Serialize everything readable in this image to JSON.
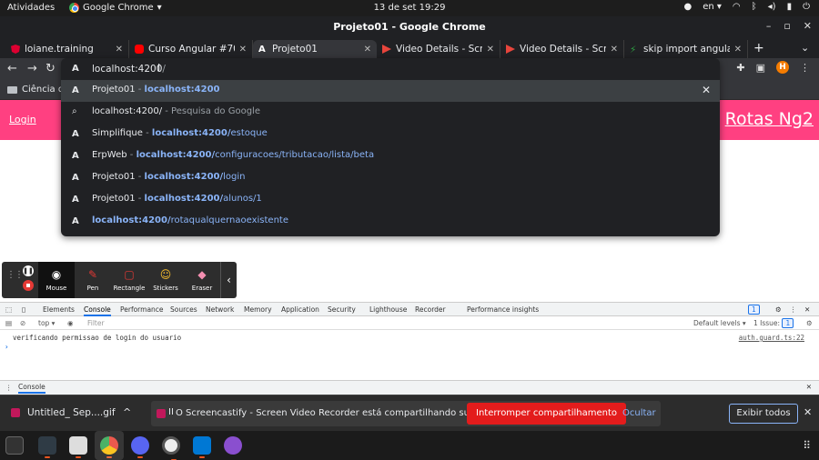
{
  "topbar": {
    "activities": "Atividades",
    "app_name": "Google Chrome",
    "clock": "13 de set  19:29",
    "lang": "en"
  },
  "window": {
    "title": "Projeto01 - Google Chrome"
  },
  "tabs": [
    {
      "label": "loiane.training"
    },
    {
      "label": "Curso Angular #70: E"
    },
    {
      "label": "Projeto01"
    },
    {
      "label": "Video Details - Scree"
    },
    {
      "label": "Video Details - Scree"
    },
    {
      "label": "skip import angular"
    }
  ],
  "bookmarks": {
    "first": "Ciência da"
  },
  "page": {
    "login_link": "Login",
    "brand": "Rotas Ng2"
  },
  "omnibox": {
    "typed": "localhost:4200",
    "typed_selected": "/",
    "suggestions": [
      {
        "pre": "Projeto01",
        "sep": " - ",
        "host": "localhost:4200",
        "path": "",
        "delete": "✕"
      },
      {
        "pre": "localhost:4200/",
        "sep": " - ",
        "host": "",
        "path": "",
        "gray": "Pesquisa do Google"
      },
      {
        "pre": "Simplifique",
        "sep": " - ",
        "host": "localhost:4200/",
        "path": "estoque"
      },
      {
        "pre": "ErpWeb",
        "sep": " - ",
        "host": "localhost:4200/",
        "path": "configuracoes/tributacao/lista/beta"
      },
      {
        "pre": "Projeto01",
        "sep": " - ",
        "host": "localhost:4200/",
        "path": "login"
      },
      {
        "pre": "Projeto01",
        "sep": " - ",
        "host": "localhost:4200/",
        "path": "alunos/1"
      },
      {
        "pre": "",
        "sep": "",
        "host": "localhost:4200/",
        "path": "rotaqualquernaoexistente"
      }
    ]
  },
  "screencastify": {
    "tools": [
      {
        "name": "Mouse"
      },
      {
        "name": "Pen"
      },
      {
        "name": "Rectangle"
      },
      {
        "name": "Stickers"
      },
      {
        "name": "Eraser"
      }
    ]
  },
  "devtools": {
    "tabs": [
      "Elements",
      "Console",
      "Performance",
      "Sources",
      "Network",
      "Memory",
      "Application",
      "Security",
      "Lighthouse",
      "Recorder",
      "Performance insights"
    ],
    "issues_badge": "1",
    "context": "top",
    "filter_placeholder": "Filter",
    "levels": "Default levels",
    "issues_count": "1 Issue:",
    "issues_num": "1",
    "log_message": "verificando permissao de login do usuario",
    "log_source": "auth.guard.ts:22",
    "prompt": "›",
    "drawer_tab": "Console"
  },
  "downloads": {
    "file": "Untitled_ Sep....gif",
    "share_message": "O Screencastify - Screen Video Recorder está compartilhando sua tela.",
    "pause_glyph": "II",
    "stop_sharing": "Interromper compartilhamento",
    "hide": "Ocultar",
    "show_all": "Exibir todos"
  },
  "colors": {
    "page_nav": "#ff4081",
    "omnibox_bg": "#202124",
    "highlight_blue": "#8ab4f8",
    "stop_red": "#e31c1c"
  }
}
